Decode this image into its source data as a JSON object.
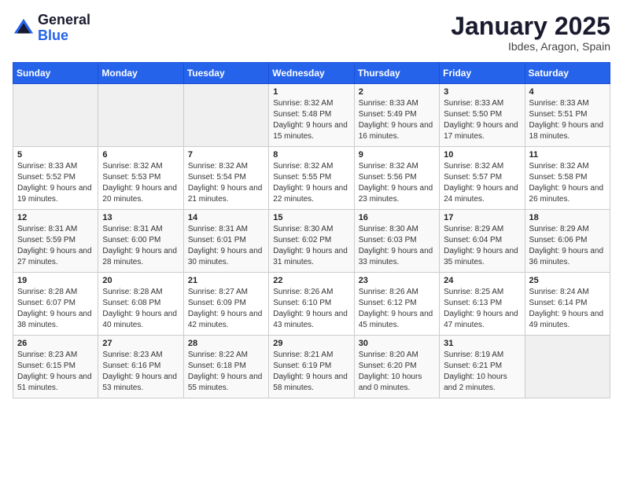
{
  "header": {
    "logo_general": "General",
    "logo_blue": "Blue",
    "month": "January 2025",
    "location": "Ibdes, Aragon, Spain"
  },
  "weekdays": [
    "Sunday",
    "Monday",
    "Tuesday",
    "Wednesday",
    "Thursday",
    "Friday",
    "Saturday"
  ],
  "weeks": [
    [
      {
        "day": "",
        "sunrise": "",
        "sunset": "",
        "daylight": ""
      },
      {
        "day": "",
        "sunrise": "",
        "sunset": "",
        "daylight": ""
      },
      {
        "day": "",
        "sunrise": "",
        "sunset": "",
        "daylight": ""
      },
      {
        "day": "1",
        "sunrise": "Sunrise: 8:32 AM",
        "sunset": "Sunset: 5:48 PM",
        "daylight": "Daylight: 9 hours and 15 minutes."
      },
      {
        "day": "2",
        "sunrise": "Sunrise: 8:33 AM",
        "sunset": "Sunset: 5:49 PM",
        "daylight": "Daylight: 9 hours and 16 minutes."
      },
      {
        "day": "3",
        "sunrise": "Sunrise: 8:33 AM",
        "sunset": "Sunset: 5:50 PM",
        "daylight": "Daylight: 9 hours and 17 minutes."
      },
      {
        "day": "4",
        "sunrise": "Sunrise: 8:33 AM",
        "sunset": "Sunset: 5:51 PM",
        "daylight": "Daylight: 9 hours and 18 minutes."
      }
    ],
    [
      {
        "day": "5",
        "sunrise": "Sunrise: 8:33 AM",
        "sunset": "Sunset: 5:52 PM",
        "daylight": "Daylight: 9 hours and 19 minutes."
      },
      {
        "day": "6",
        "sunrise": "Sunrise: 8:32 AM",
        "sunset": "Sunset: 5:53 PM",
        "daylight": "Daylight: 9 hours and 20 minutes."
      },
      {
        "day": "7",
        "sunrise": "Sunrise: 8:32 AM",
        "sunset": "Sunset: 5:54 PM",
        "daylight": "Daylight: 9 hours and 21 minutes."
      },
      {
        "day": "8",
        "sunrise": "Sunrise: 8:32 AM",
        "sunset": "Sunset: 5:55 PM",
        "daylight": "Daylight: 9 hours and 22 minutes."
      },
      {
        "day": "9",
        "sunrise": "Sunrise: 8:32 AM",
        "sunset": "Sunset: 5:56 PM",
        "daylight": "Daylight: 9 hours and 23 minutes."
      },
      {
        "day": "10",
        "sunrise": "Sunrise: 8:32 AM",
        "sunset": "Sunset: 5:57 PM",
        "daylight": "Daylight: 9 hours and 24 minutes."
      },
      {
        "day": "11",
        "sunrise": "Sunrise: 8:32 AM",
        "sunset": "Sunset: 5:58 PM",
        "daylight": "Daylight: 9 hours and 26 minutes."
      }
    ],
    [
      {
        "day": "12",
        "sunrise": "Sunrise: 8:31 AM",
        "sunset": "Sunset: 5:59 PM",
        "daylight": "Daylight: 9 hours and 27 minutes."
      },
      {
        "day": "13",
        "sunrise": "Sunrise: 8:31 AM",
        "sunset": "Sunset: 6:00 PM",
        "daylight": "Daylight: 9 hours and 28 minutes."
      },
      {
        "day": "14",
        "sunrise": "Sunrise: 8:31 AM",
        "sunset": "Sunset: 6:01 PM",
        "daylight": "Daylight: 9 hours and 30 minutes."
      },
      {
        "day": "15",
        "sunrise": "Sunrise: 8:30 AM",
        "sunset": "Sunset: 6:02 PM",
        "daylight": "Daylight: 9 hours and 31 minutes."
      },
      {
        "day": "16",
        "sunrise": "Sunrise: 8:30 AM",
        "sunset": "Sunset: 6:03 PM",
        "daylight": "Daylight: 9 hours and 33 minutes."
      },
      {
        "day": "17",
        "sunrise": "Sunrise: 8:29 AM",
        "sunset": "Sunset: 6:04 PM",
        "daylight": "Daylight: 9 hours and 35 minutes."
      },
      {
        "day": "18",
        "sunrise": "Sunrise: 8:29 AM",
        "sunset": "Sunset: 6:06 PM",
        "daylight": "Daylight: 9 hours and 36 minutes."
      }
    ],
    [
      {
        "day": "19",
        "sunrise": "Sunrise: 8:28 AM",
        "sunset": "Sunset: 6:07 PM",
        "daylight": "Daylight: 9 hours and 38 minutes."
      },
      {
        "day": "20",
        "sunrise": "Sunrise: 8:28 AM",
        "sunset": "Sunset: 6:08 PM",
        "daylight": "Daylight: 9 hours and 40 minutes."
      },
      {
        "day": "21",
        "sunrise": "Sunrise: 8:27 AM",
        "sunset": "Sunset: 6:09 PM",
        "daylight": "Daylight: 9 hours and 42 minutes."
      },
      {
        "day": "22",
        "sunrise": "Sunrise: 8:26 AM",
        "sunset": "Sunset: 6:10 PM",
        "daylight": "Daylight: 9 hours and 43 minutes."
      },
      {
        "day": "23",
        "sunrise": "Sunrise: 8:26 AM",
        "sunset": "Sunset: 6:12 PM",
        "daylight": "Daylight: 9 hours and 45 minutes."
      },
      {
        "day": "24",
        "sunrise": "Sunrise: 8:25 AM",
        "sunset": "Sunset: 6:13 PM",
        "daylight": "Daylight: 9 hours and 47 minutes."
      },
      {
        "day": "25",
        "sunrise": "Sunrise: 8:24 AM",
        "sunset": "Sunset: 6:14 PM",
        "daylight": "Daylight: 9 hours and 49 minutes."
      }
    ],
    [
      {
        "day": "26",
        "sunrise": "Sunrise: 8:23 AM",
        "sunset": "Sunset: 6:15 PM",
        "daylight": "Daylight: 9 hours and 51 minutes."
      },
      {
        "day": "27",
        "sunrise": "Sunrise: 8:23 AM",
        "sunset": "Sunset: 6:16 PM",
        "daylight": "Daylight: 9 hours and 53 minutes."
      },
      {
        "day": "28",
        "sunrise": "Sunrise: 8:22 AM",
        "sunset": "Sunset: 6:18 PM",
        "daylight": "Daylight: 9 hours and 55 minutes."
      },
      {
        "day": "29",
        "sunrise": "Sunrise: 8:21 AM",
        "sunset": "Sunset: 6:19 PM",
        "daylight": "Daylight: 9 hours and 58 minutes."
      },
      {
        "day": "30",
        "sunrise": "Sunrise: 8:20 AM",
        "sunset": "Sunset: 6:20 PM",
        "daylight": "Daylight: 10 hours and 0 minutes."
      },
      {
        "day": "31",
        "sunrise": "Sunrise: 8:19 AM",
        "sunset": "Sunset: 6:21 PM",
        "daylight": "Daylight: 10 hours and 2 minutes."
      },
      {
        "day": "",
        "sunrise": "",
        "sunset": "",
        "daylight": ""
      }
    ]
  ]
}
